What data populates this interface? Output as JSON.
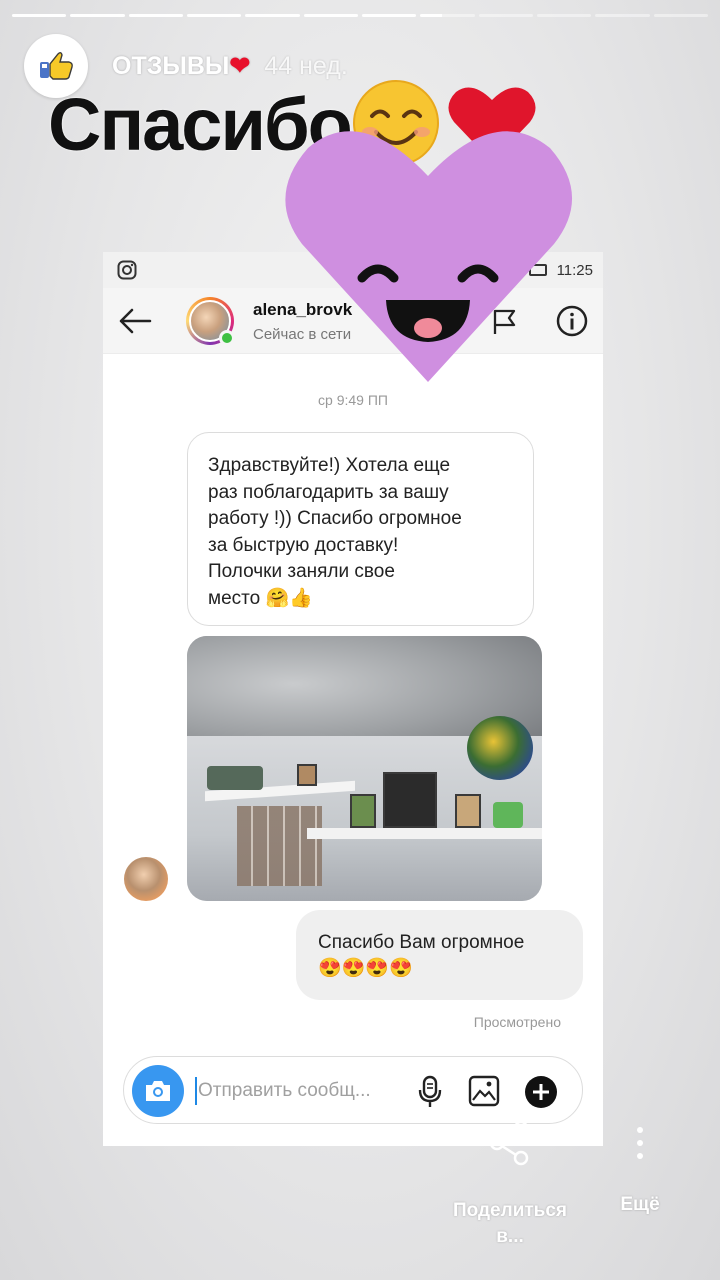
{
  "story": {
    "progress_segments": 12,
    "progress_current": 7,
    "progress_current_fill": 0.4,
    "account_name": "ОТЗЫВЫ",
    "account_name_emoji": "❤",
    "age": "44 нед.",
    "avatar_icon": "thumbs-up-icon"
  },
  "caption": {
    "text": "Спасибо",
    "emojis": [
      "smiling-face-icon",
      "red-heart-icon"
    ]
  },
  "sticker": {
    "name": "purple-heart-smile-sticker",
    "color": "#cf8fe0"
  },
  "dm_screenshot": {
    "status_bar": {
      "time": "11:25"
    },
    "header": {
      "username": "alena_brovk",
      "status": "Сейчас в сети",
      "online_color": "#3ec042"
    },
    "timestamp": "ср 9:49 ПП",
    "incoming_message": "Здравствуйте!) Хотела еще\nраз поблагодарить за вашу\nработу !)) Спасибо огромное\nза быструю доставку!\nПолочки заняли свое\nместо 🤗👍",
    "photo_alt": "Стена с белыми полками, фоторамками и букетом",
    "outgoing_message_text": "Спасибо Вам огромное",
    "outgoing_message_emojis": "😍😍😍😍",
    "seen": "Просмотрено",
    "composer": {
      "placeholder": "Отправить сообщ..."
    }
  },
  "actions": {
    "share_label_1": "Поделиться",
    "share_label_2": "в...",
    "more_label": "Ещё"
  },
  "colors": {
    "accent_blue": "#3897f0",
    "caption_text": "#111111",
    "heart_red": "#e8102b"
  }
}
